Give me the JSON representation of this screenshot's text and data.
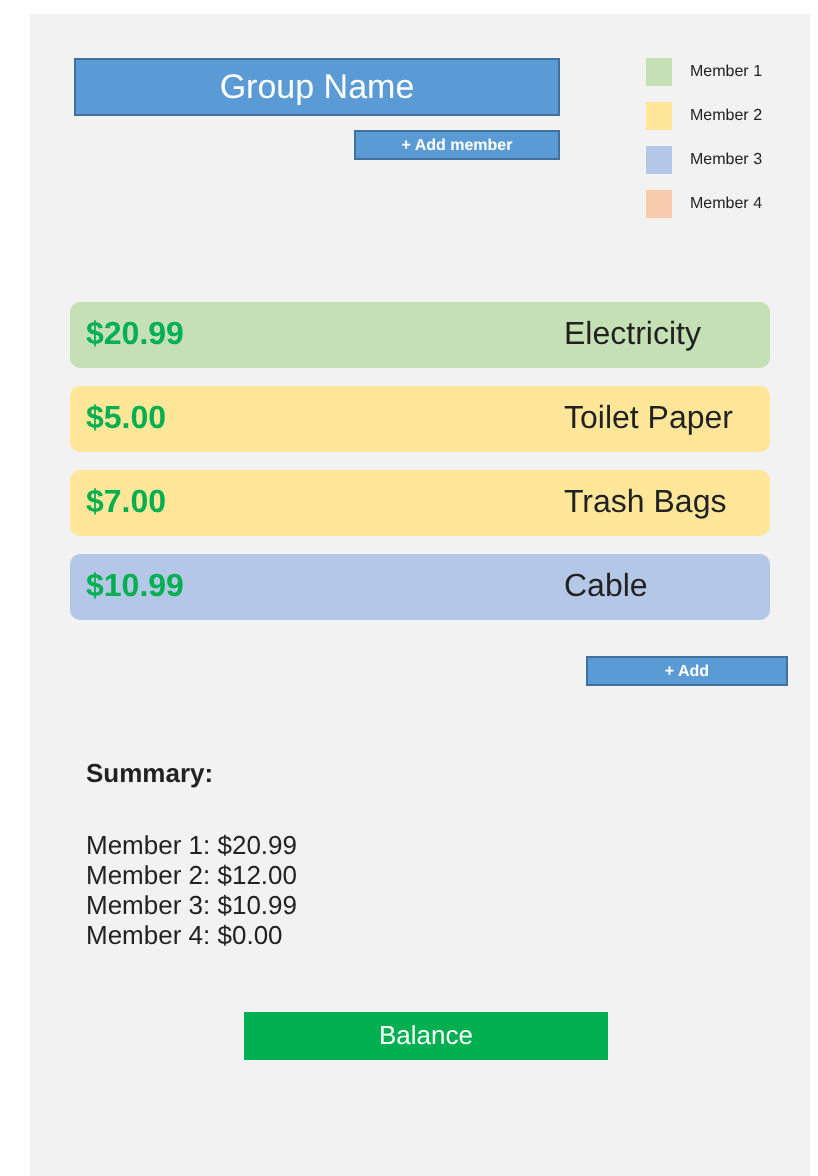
{
  "group_name": "Group Name",
  "add_member_button": "+ Add member",
  "legend": [
    {
      "label": "Member 1",
      "color": "#c5e0b4"
    },
    {
      "label": "Member 2",
      "color": "#ffe699"
    },
    {
      "label": "Member 3",
      "color": "#b4c7e7"
    },
    {
      "label": "Member 4",
      "color": "#f8cbad"
    }
  ],
  "expenses": [
    {
      "amount": "$20.99",
      "name": "Electricity",
      "color": "#c5e0b4"
    },
    {
      "amount": "$5.00",
      "name": "Toilet Paper",
      "color": "#ffe699"
    },
    {
      "amount": "$7.00",
      "name": "Trash Bags",
      "color": "#ffe699"
    },
    {
      "amount": "$10.99",
      "name": "Cable",
      "color": "#b4c7e7"
    }
  ],
  "add_button": "+ Add",
  "summary": {
    "title": "Summary:",
    "lines": [
      "Member 1: $20.99",
      "Member 2: $12.00",
      "Member 3: $10.99",
      "Member 4: $0.00"
    ]
  },
  "balance_button": "Balance"
}
